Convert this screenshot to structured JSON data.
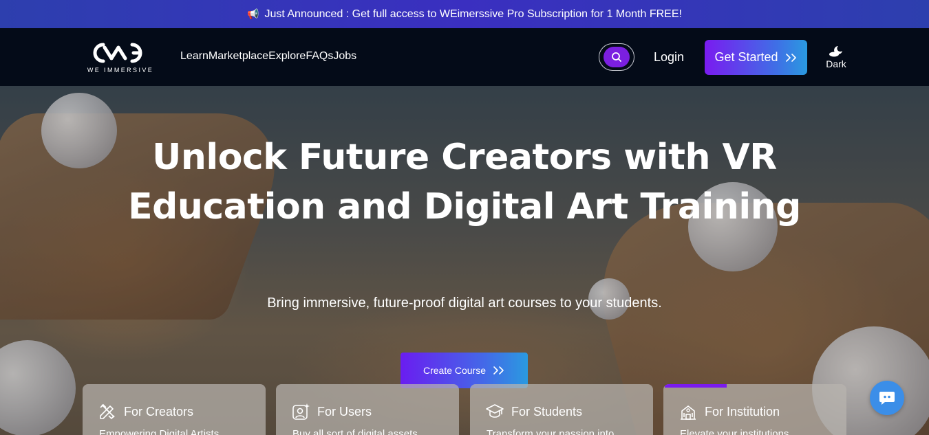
{
  "announcement": {
    "icon": "megaphone-icon",
    "text": "Just Announced : Get full access to WEimerssive Pro Subscription for 1 Month FREE!"
  },
  "nav": {
    "logo_text": "WE IMMERSIVE",
    "links": [
      "Learn",
      "Marketplace",
      "Explore",
      "FAQs",
      "Jobs"
    ],
    "search_icon": "search-icon",
    "login_label": "Login",
    "get_started_label": "Get Started",
    "theme_label": "Dark"
  },
  "hero": {
    "title": "Unlock Future Creators with VR Education and Digital Art Training",
    "subtitle": "Bring immersive, future-proof digital art courses to your students.",
    "cta_label": "Create Course"
  },
  "cards": [
    {
      "icon": "pencil-ruler-icon",
      "title": "For Creators",
      "desc": "Empowering Digital Artists"
    },
    {
      "icon": "user-sparkle-icon",
      "title": "For Users",
      "desc": "Buy all sort of digital assets"
    },
    {
      "icon": "graduation-cap-icon",
      "title": "For Students",
      "desc": "Transform your passion into"
    },
    {
      "icon": "institution-icon",
      "title": "For Institution",
      "desc": "Elevate your institutions"
    }
  ],
  "colors": {
    "accent_purple": "#7a1bf0",
    "accent_blue": "#2a9ae0",
    "navbar_bg": "#040b18",
    "chat_button": "#3b8ee8"
  }
}
